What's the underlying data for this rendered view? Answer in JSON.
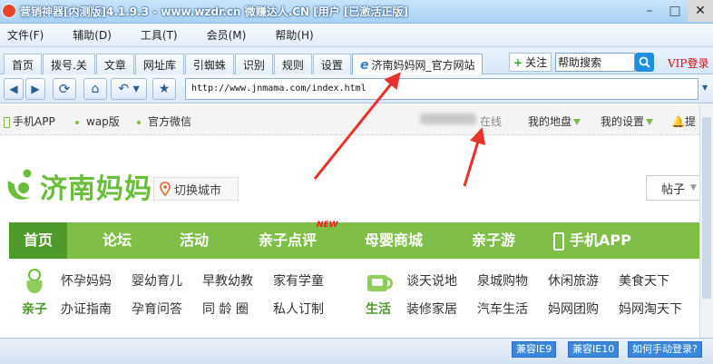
{
  "window": {
    "title": "营销神器[内测版]4.1.9.3 - www.wzdr.cn 微赚达人.CN [用户 [已激活正版]"
  },
  "menu": [
    "文件(F)",
    "辅助(D)",
    "工具(T)",
    "会员(M)",
    "帮助(H)"
  ],
  "tabs": [
    "首页",
    "拨号.关",
    "文章",
    "网址库",
    "引蜘蛛",
    "识别",
    "规则",
    "设置"
  ],
  "active_tab": "济南妈妈网_官方网站",
  "follow_label": "关注",
  "help_search": {
    "value": "帮助搜索"
  },
  "vip_login": "VIP登录",
  "address": {
    "url": "http://www.jnmama.com/index.html"
  },
  "site": {
    "topstrip": {
      "mobile_app": "手机APP",
      "wap": "wap版",
      "wechat": "官方微信",
      "online": "在线",
      "my_area": "我的地盘",
      "my_settings": "我的设置",
      "remind": "提"
    },
    "logo_text": "济南妈妈",
    "city_switch": "切换城市",
    "post_select": "帖子",
    "nav": [
      "首页",
      "论坛",
      "活动",
      "亲子点评",
      "母婴商城",
      "亲子游",
      "手机APP"
    ],
    "new_badge": "NEW",
    "cat1": {
      "label": "亲子",
      "row1": [
        "怀孕妈妈",
        "婴幼育儿",
        "早教幼教",
        "家有学童"
      ],
      "row2": [
        "办证指南",
        "孕育问答",
        "同 龄 圈",
        "私人订制"
      ]
    },
    "cat2": {
      "label": "生活",
      "row1": [
        "谈天说地",
        "泉城购物",
        "休闲旅游",
        "美食天下"
      ],
      "row2": [
        "装修家居",
        "汽车生活",
        "妈网团购",
        "妈网淘天下"
      ]
    }
  },
  "status": {
    "ie9": "兼容IE9",
    "ie10": "兼容IE10",
    "manual_login": "如何手动登录?"
  },
  "colors": {
    "brand_green": "#7fbf48",
    "nav_active": "#4e9a2b",
    "annotation_red": "#e8322b",
    "title_bar": "#a7d1f3"
  }
}
